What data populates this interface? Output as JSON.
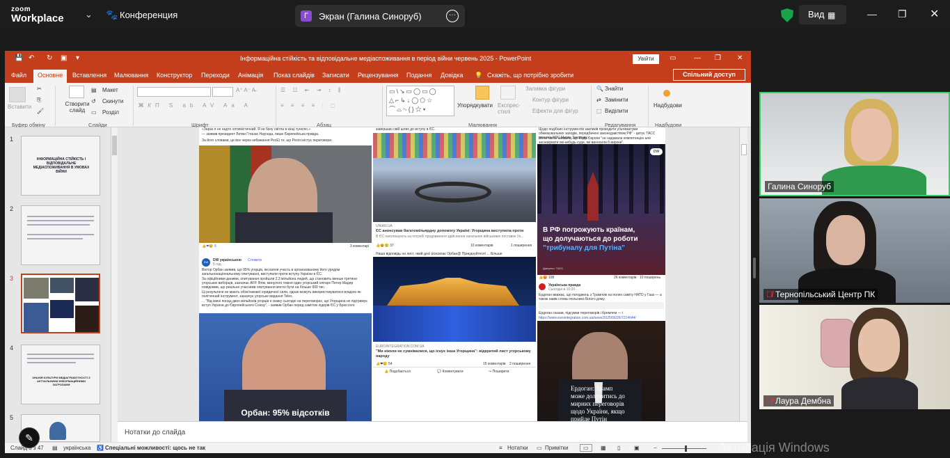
{
  "zoom": {
    "logo_top": "zoom",
    "logo_bottom": "Workplace",
    "conference_label": "Конференция",
    "share_avatar": "Г",
    "share_label": "Экран (Галина Синоруб)",
    "view_label": "Вид"
  },
  "ppt": {
    "title": "Інформаційна стійкість та відповідальне медіаспоживання в період війни червень 2025  -  PowerPoint",
    "signin": "Увійти",
    "share": "Спільний доступ",
    "tabs": [
      "Файл",
      "Основне",
      "Вставлення",
      "Малювання",
      "Конструктор",
      "Переходи",
      "Анімація",
      "Показ слайдів",
      "Записати",
      "Рецензування",
      "Подання",
      "Довідка"
    ],
    "tell_me": "Скажіть, що потрібно зробити",
    "ribbon": {
      "paste": "Вставити",
      "clipboard": "Буфер обміну",
      "new_slide": "Створити слайд",
      "layout": "Макет",
      "reset": "Скинути",
      "sections": "Розділ",
      "slides": "Слайди",
      "font": "Шрифт",
      "paragraph": "Абзац",
      "arrange": "Упорядкувати",
      "quick_styles": "Експрес-стилі",
      "shape_fill": "Заливка фігури",
      "shape_outline": "Контур фігури",
      "shape_effects": "Ефекти для фігур",
      "drawing": "Малювання",
      "find": "Знайти",
      "replace": "Замінити",
      "select": "Виділити",
      "editing": "Редагування",
      "addins": "Надбудови",
      "addins_group": "Надбудови"
    },
    "thumbs": [
      {
        "num": "1",
        "text": "ІНФОРМАЦІЙНА СТІЙКІСТЬ І ВІДПОВІДАЛЬНЕ МЕДІАСПОЖИВАННЯ В УМОВАХ ВІЙНИ"
      },
      {
        "num": "2",
        "text": ""
      },
      {
        "num": "3",
        "text": ""
      },
      {
        "num": "4",
        "text": "ЗНАНІЯ КУЛЬТУРИ МЕДІАГРАМОТНОСТІ З АКТУАЛЬНИМИ ІНФОРМАЦІЙНИМИ ЗАГРОЗАМИ"
      },
      {
        "num": "5",
        "text": ""
      }
    ],
    "slide": {
      "post1_top": "«Зараз я не надто оптимістичний. Я не бачу світла в кінці тунелю.»",
      "post1_line2": "— заявив президент Литви Гітанас Науседа, пише Європейська правда.",
      "post1_line3": "За його словами, це все через небажання РосЕ) те, що Росія іністує переговори.",
      "post1_comments": "3 коментарі",
      "post1_likes": "5",
      "post2_top": "завершаю свій шлях до вступу в ЄС.",
      "post2_source": "UNIAN.UA",
      "post2_title": "ЄС анонсував багатомільярдну допомогу Україні: Угорщина виступила проти",
      "post2_desc": "В ЄС наголошують на потребі продовження здійснення нагальних військових поставок Ук...",
      "post2_likes": "37",
      "post2_comments": "10 коментарів",
      "post2_shares": "1 поширення",
      "post3_top": "Щодо подібних інструментів закликів проводити ультиматуми обмежувальних заходів, передбачені законодавством РФ\" - цитує ТАСС речника МЗС Марію Захарову.",
      "post3_line2": "Вона також заявила, що Рада Європи \"не надавала компетенцію але засновувати які-небудь суди, які виносили б вироки\".",
      "post3_img_line1": "В РФ погрожують країнам,",
      "post3_img_line2": "що долучаються до роботи",
      "post3_img_line3": "\"трибуналу для Путіна\"",
      "post3_photo": "Джерело: ТАСС",
      "post3_stats": "26 коментарів · 10 поширень",
      "post3_likes": "108",
      "post4_author": "DW українською",
      "post4_follow": "Стежити",
      "post4_time": "5 год. ·",
      "post4_text": "Віктор Орбан заявив, що 95% угорців, які взяли участь в організованому його урядом загальнонаціональному опитуванні, виступили проти вступу України в ЄС.",
      "post4_text2": "За офіційними даними, опитування пройшли 2,3 мільйона людей, що становить менше третини угорських виборців, зазначає AFP. Втім, минулого тижня один угорський олігарх Петер Мадяр повідомив, що реально учасників опитування могло бути на більше 600 тис.",
      "post4_text3": "Ці результати не мають обов'язкової юридичної сили, однак можуть використовуватися владою як політичний інструмент, зазначує угорське видання Telex.",
      "post4_text4": "... \"Від імені понад двох мільйонів угорців я скажу сьогодні на переговорах, що Угорщина не підтримує вступ України до Європейського Союзу\", - заявив Орбан перед самітом лідерів ЄС у Брюсселі.",
      "post4_caption": "Орбан: 95% відсотків",
      "post5_top": "Наша відповідь на лист, який досі розсилає Орбан@ Приєднуйтеся! ... Більше",
      "post5_source": "EUROINTEGRATION.COM.UA",
      "post5_title": "\"Ми ніколи не сумнівалися, що існує інша Угорщина\": відкритий лист угорському народу",
      "post5_likes": "54",
      "post5_comments": "15 коментарів",
      "post5_shares": "2 поширення",
      "post5_like": "Подобається",
      "post5_comment": "Коментувати",
      "post5_share": "Поширити",
      "post6_author": "Українська правда",
      "post6_time": "Сьогодні в 10:20 ·",
      "post6_text": "Ердоган вважає, що погоджень з Трампом на полях саміту НАТО у Гааз — а також навів слова очільника Білого дому.",
      "post6_link": "https://www.eurointegration.com.ua/news/2025/06/26/7214644/",
      "post6_line2": "Ердоган сказав, підсумки переговорів і Кремлем — і ",
      "post6_caption1": "Ердоган: Трамп",
      "post6_caption2": "може долучитись до",
      "post6_caption3": "мирних переговорів",
      "post6_caption4": "щодо України, якщо",
      "post6_caption5": "прийде Путін"
    },
    "notes": "Нотатки до слайда",
    "status": {
      "slide": "Слайд 3 з 47",
      "language": "українська",
      "accessibility": "Спеціальні можливості: щось не так",
      "notes_btn": "Нотатки",
      "comments_btn": "Примітки"
    }
  },
  "participants": [
    {
      "name": "Галина Синоруб",
      "muted": false
    },
    {
      "name": "Тернопільський Центр ПК",
      "muted": true
    },
    {
      "name": "Лаура Дембна",
      "muted": true
    }
  ],
  "watermark": "Активація Windows",
  "colors": {
    "ppt_red": "#c43e1c",
    "zoom_green": "#19a34a",
    "active_speaker": "#2ed35e"
  }
}
